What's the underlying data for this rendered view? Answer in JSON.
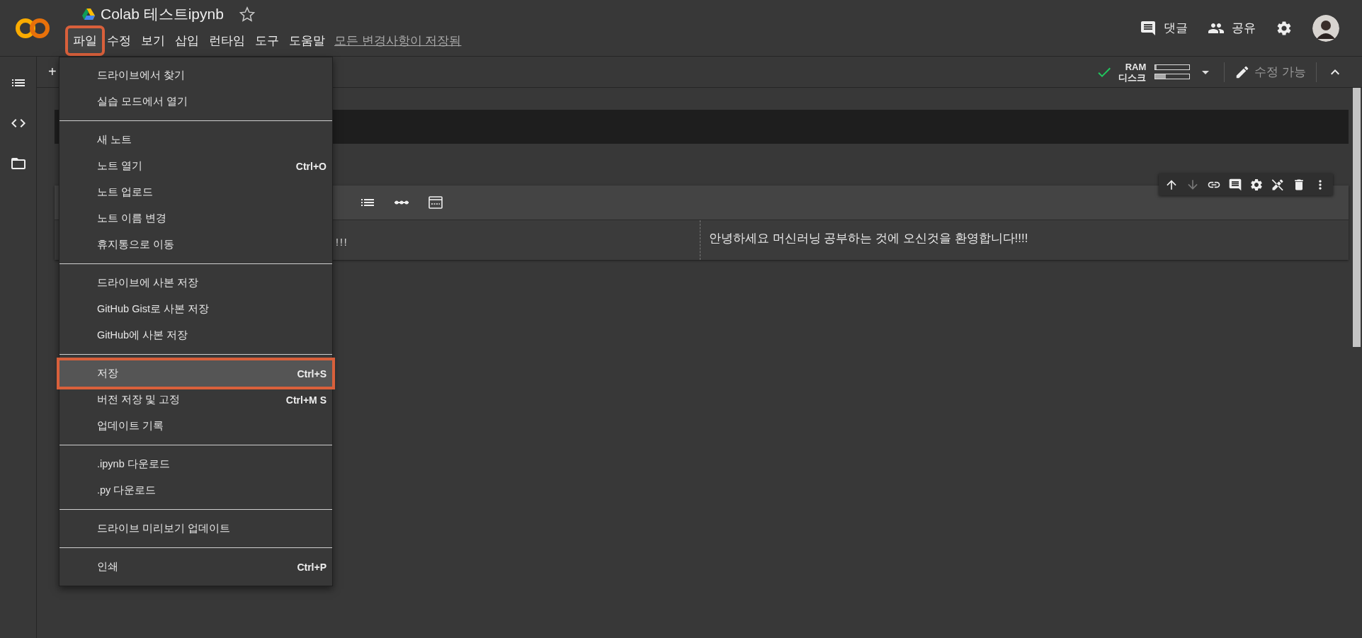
{
  "header": {
    "title": "Colab 테스트ipynb",
    "starred": false,
    "actions": [
      {
        "kind": "comment",
        "label": "댓글"
      },
      {
        "kind": "share",
        "label": "공유"
      }
    ]
  },
  "menubar": {
    "items": [
      {
        "label": "파일",
        "selected": true,
        "annotated": true
      },
      {
        "label": "수정",
        "selected": false,
        "annotated": false
      },
      {
        "label": "보기",
        "selected": false,
        "annotated": false
      },
      {
        "label": "삽입",
        "selected": false,
        "annotated": false
      },
      {
        "label": "런타임",
        "selected": false,
        "annotated": false
      },
      {
        "label": "도구",
        "selected": false,
        "annotated": false
      },
      {
        "label": "도움말",
        "selected": false,
        "annotated": false
      }
    ],
    "save_status": "모든 변경사항이 저장됨"
  },
  "toolbar": {
    "add_button": "+",
    "resources": [
      {
        "label": "RAM",
        "level": 0.03
      },
      {
        "label": "디스크",
        "level": 0.3
      }
    ],
    "connected": true,
    "edit_mode": {
      "label": "수정 가능",
      "disabled": true
    }
  },
  "cell_toolbar": [
    {
      "kind": "move-up",
      "disabled": false
    },
    {
      "kind": "move-down",
      "disabled": true
    },
    {
      "kind": "link",
      "disabled": false
    },
    {
      "kind": "comment",
      "disabled": false
    },
    {
      "kind": "settings",
      "disabled": false
    },
    {
      "kind": "no-edit",
      "disabled": false
    },
    {
      "kind": "delete",
      "disabled": false
    },
    {
      "kind": "more",
      "disabled": false
    }
  ],
  "text_cell": {
    "source_tail": "!!!",
    "preview": "안녕하세요 머신러닝 공부하는 것에 오신것을 환영합니다!!!!"
  },
  "file_menu": {
    "groups": [
      {
        "items": [
          {
            "label": "드라이브에서 찾기",
            "selected": false,
            "annotated": false
          },
          {
            "label": "실습 모드에서 열기",
            "selected": false,
            "annotated": false
          }
        ]
      },
      {
        "items": [
          {
            "label": "새 노트",
            "selected": false,
            "annotated": false
          },
          {
            "label": "노트 열기",
            "shortcut": "Ctrl+O",
            "selected": false,
            "annotated": false
          },
          {
            "label": "노트 업로드",
            "selected": false,
            "annotated": false
          },
          {
            "label": "노트 이름 변경",
            "selected": false,
            "annotated": false
          },
          {
            "label": "휴지통으로 이동",
            "selected": false,
            "annotated": false
          }
        ]
      },
      {
        "items": [
          {
            "label": "드라이브에 사본 저장",
            "selected": false,
            "annotated": false
          },
          {
            "label": "GitHub Gist로 사본 저장",
            "selected": false,
            "annotated": false
          },
          {
            "label": "GitHub에 사본 저장",
            "selected": false,
            "annotated": false
          }
        ]
      },
      {
        "items": [
          {
            "label": "저장",
            "shortcut": "Ctrl+S",
            "selected": true,
            "annotated": true
          },
          {
            "label": "버전 저장 및 고정",
            "shortcut": "Ctrl+M S",
            "selected": false,
            "annotated": false
          },
          {
            "label": "업데이트 기록",
            "selected": false,
            "annotated": false
          }
        ]
      },
      {
        "items": [
          {
            "label": ".ipynb 다운로드",
            "selected": false,
            "annotated": false
          },
          {
            "label": ".py 다운로드",
            "selected": false,
            "annotated": false
          }
        ]
      },
      {
        "items": [
          {
            "label": "드라이브 미리보기 업데이트",
            "selected": false,
            "annotated": false
          }
        ]
      },
      {
        "items": [
          {
            "label": "인쇄",
            "shortcut": "Ctrl+P",
            "selected": false,
            "annotated": false
          }
        ]
      }
    ]
  }
}
